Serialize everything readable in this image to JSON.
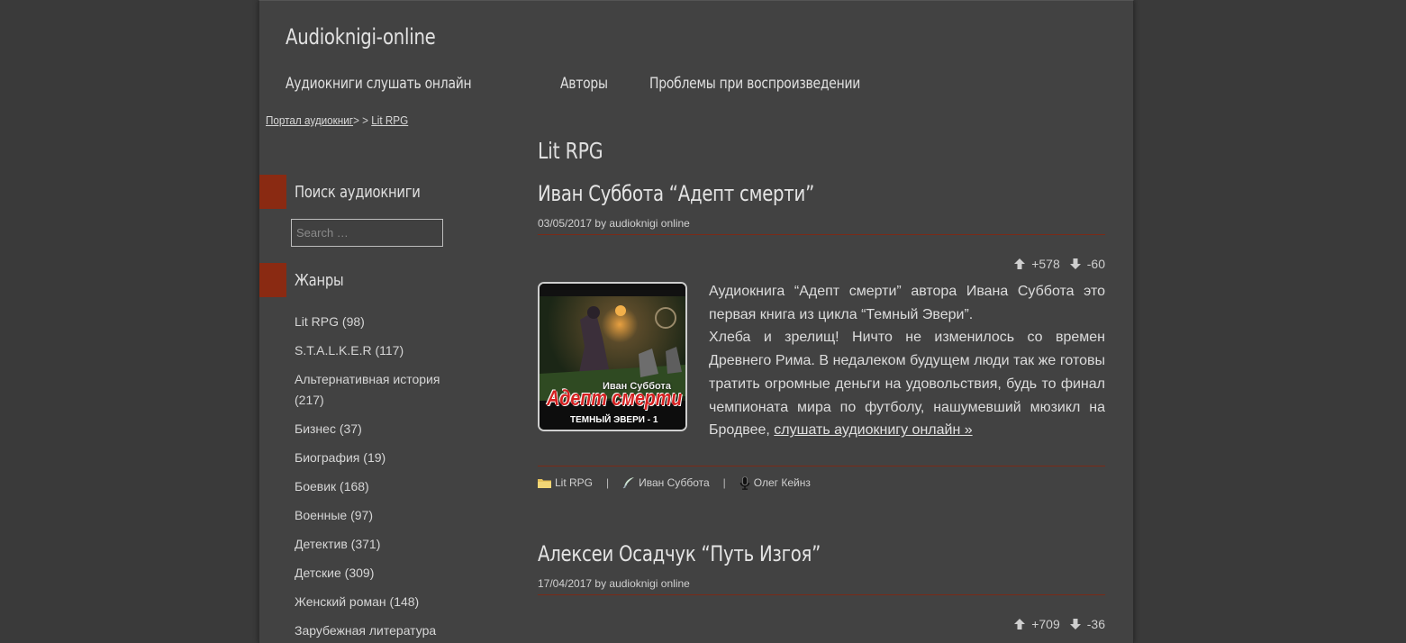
{
  "site": {
    "title": "Audioknigi-online"
  },
  "nav": [
    {
      "label": "Аудиокниги слушать онлайн"
    },
    {
      "label": "Авторы"
    },
    {
      "label": "Проблемы при воспроизведении"
    }
  ],
  "breadcrumb": {
    "home": "Портал аудиокниг",
    "sep": "> > ",
    "current": "Lit RPG"
  },
  "sidebar": {
    "search_title": "Поиск аудиокниги",
    "search_placeholder": "Search …",
    "genres_title": "Жанры",
    "genres": [
      "Lit RPG (98)",
      "S.T.A.L.K.E.R (117)",
      "Альтернативная история (217)",
      "Бизнес (37)",
      "Биография (19)",
      "Боевик (168)",
      "Военные (97)",
      "Детектив (371)",
      "Детские (309)",
      "Женский роман (148)",
      "Зарубежная литература"
    ]
  },
  "category_title": "Lit RPG",
  "posts": [
    {
      "title": "Иван Суббота “Адепт смерти”",
      "meta": "03/05/2017 by audioknigi online",
      "up": "+578",
      "down": "-60",
      "cover_author": "Иван Суббота",
      "cover_title": "Адепт смерти",
      "cover_series": "ТЕМНЫЙ ЭВЕРИ - 1",
      "desc_p1": "Аудиокнига “Адепт смерти” автора Ивана Суббота это первая книга из цикла “Темный Эвери”.",
      "desc_p2": "Хлеба и зрелищ! Ничто не изменилось со времен Древнего Рима. В недалеком будущем люди так же готовы тратить огромные деньги на удовольствия, будь то финал чемпионата мира по футболу, нашумевший мюзикл на Бродвее,",
      "read_more": "слушать аудиокнигу онлайн »",
      "tag_genre": "Lit RPG",
      "tag_author": "Иван Суббота",
      "tag_reader": "Олег Кейнз"
    },
    {
      "title": "Алексеи Осадчук “Путь Изгоя”",
      "meta": "17/04/2017 by audioknigi online",
      "up": "+709",
      "down": "-36"
    }
  ]
}
